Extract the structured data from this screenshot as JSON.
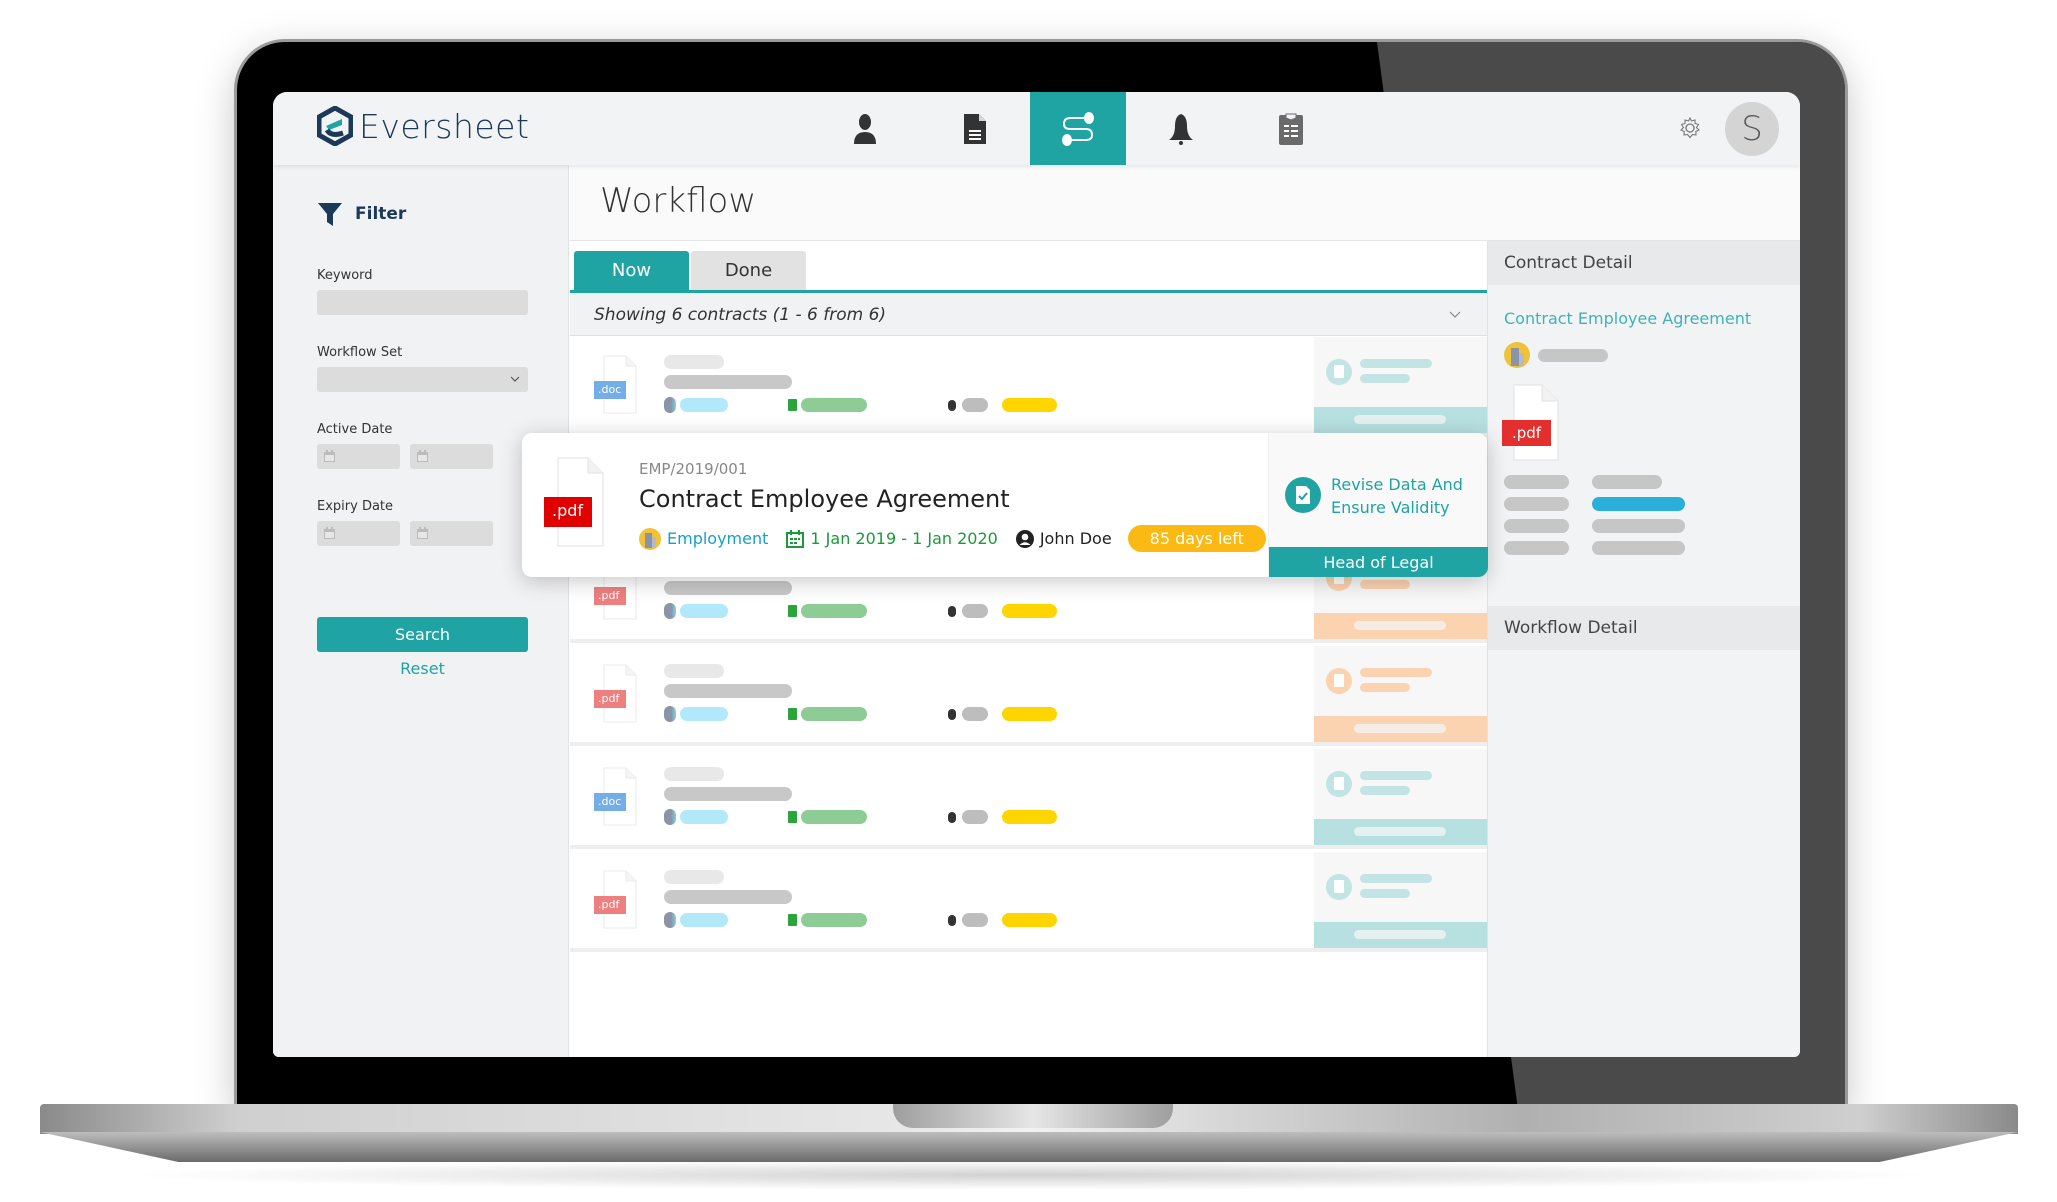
{
  "app": {
    "name": "Eversheet",
    "brand_color": "#1fa3a3",
    "brand_dark": "#1a3a58"
  },
  "topbar": {
    "nav": [
      {
        "icon": "user-icon",
        "active": false
      },
      {
        "icon": "document-icon",
        "active": false
      },
      {
        "icon": "workflow-icon",
        "active": true
      },
      {
        "icon": "bell-icon",
        "active": false
      },
      {
        "icon": "clipboard-icon",
        "active": false
      }
    ],
    "settings_icon": "gear-icon",
    "avatar_initial": "S"
  },
  "sidebar": {
    "filter_title": "Filter",
    "keyword_label": "Keyword",
    "keyword_value": "",
    "workflow_set_label": "Workflow Set",
    "workflow_set_value": "",
    "active_date_label": "Active Date",
    "expiry_date_label": "Expiry Date",
    "search_label": "Search",
    "reset_label": "Reset"
  },
  "main": {
    "title": "Workflow",
    "tabs": [
      {
        "label": "Now",
        "active": true
      },
      {
        "label": "Done",
        "active": false
      }
    ],
    "showing_text": "Showing 6 contracts (1 - 6 from 6)",
    "rows": [
      {
        "file_type": ".doc",
        "status_color": "teal"
      },
      {
        "file_type": ".pdf",
        "status_color": "teal",
        "featured": true
      },
      {
        "file_type": ".pdf",
        "status_color": "orange"
      },
      {
        "file_type": ".pdf",
        "status_color": "orange"
      },
      {
        "file_type": ".doc",
        "status_color": "teal"
      },
      {
        "file_type": ".pdf",
        "status_color": "teal"
      }
    ],
    "featured": {
      "file_type": ".pdf",
      "code": "EMP/2019/001",
      "title": "Contract Employee Agreement",
      "category": "Employment",
      "period": "1 Jan 2019 - 1 Jan 2020",
      "owner": "John Doe",
      "days_left": "85 days left",
      "task": "Revise Data And Ensure Validity",
      "role": "Head of Legal"
    }
  },
  "detail": {
    "contract_header": "Contract Detail",
    "contract_title": "Contract Employee Agreement",
    "file_type": ".pdf",
    "workflow_header": "Workflow Detail"
  }
}
